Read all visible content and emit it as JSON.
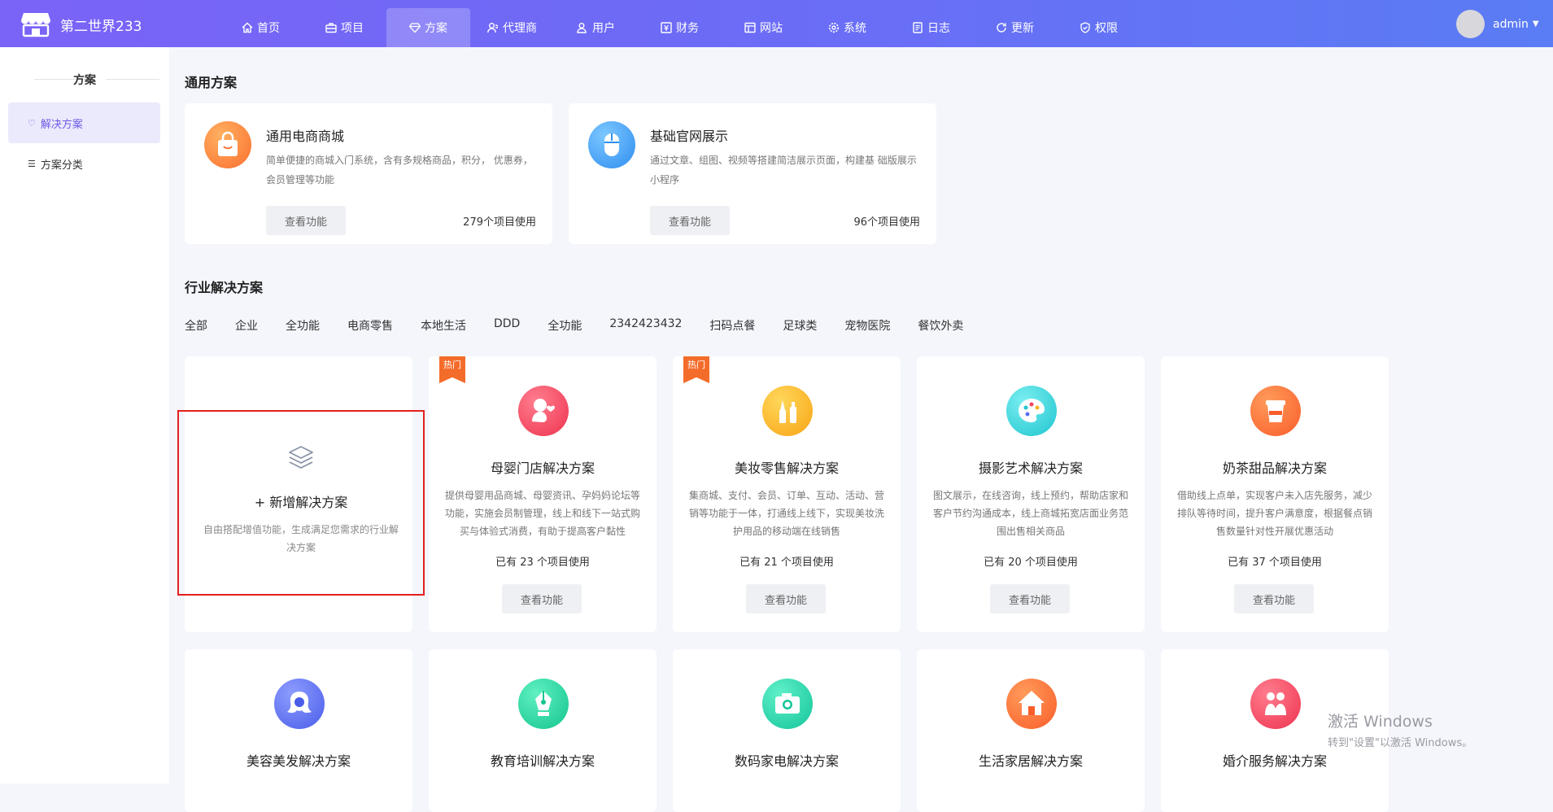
{
  "app": {
    "title": "第二世界233"
  },
  "nav": [
    {
      "label": "首页",
      "icon": "home-icon"
    },
    {
      "label": "项目",
      "icon": "briefcase-icon"
    },
    {
      "label": "方案",
      "icon": "diamond-icon",
      "active": true
    },
    {
      "label": "代理商",
      "icon": "agent-icon"
    },
    {
      "label": "用户",
      "icon": "users-icon"
    },
    {
      "label": "财务",
      "icon": "finance-icon"
    },
    {
      "label": "网站",
      "icon": "website-icon"
    },
    {
      "label": "系统",
      "icon": "gear-icon"
    },
    {
      "label": "日志",
      "icon": "log-icon"
    },
    {
      "label": "更新",
      "icon": "refresh-icon"
    },
    {
      "label": "权限",
      "icon": "shield-icon"
    }
  ],
  "user": {
    "name": "admin"
  },
  "sidebar": {
    "title": "方案",
    "items": [
      {
        "label": "解决方案",
        "icon": "diamond-icon",
        "active": true
      },
      {
        "label": "方案分类",
        "icon": "list-icon"
      }
    ]
  },
  "general": {
    "title": "通用方案",
    "cards": [
      {
        "name": "通用电商商城",
        "desc": "简单便捷的商城入门系统，含有多规格商品，积分， 优惠券，会员管理等功能",
        "button": "查看功能",
        "count": "279个项目使用",
        "icon": "shopping-bag-icon",
        "color": "#fb7a3a"
      },
      {
        "name": "基础官网展示",
        "desc": "通过文章、组图、视频等搭建简洁展示页面，构建基 础版展示小程序",
        "button": "查看功能",
        "count": "96个项目使用",
        "icon": "mouse-icon",
        "color": "#3d9df2"
      }
    ]
  },
  "industry": {
    "title": "行业解决方案",
    "filters": [
      "全部",
      "企业",
      "全功能",
      "电商零售",
      "本地生活",
      "DDD",
      "全功能",
      "2342423432",
      "扫码点餐",
      "足球类",
      "宠物医院",
      "餐饮外卖"
    ],
    "add": {
      "title": "+ 新增解决方案",
      "desc": "自由搭配增值功能，生成满足您需求的行业解决方案",
      "icon": "layers-icon"
    },
    "cards": [
      {
        "name": "母婴门店解决方案",
        "badge": "热门",
        "desc": "提供母婴用品商城、母婴资讯、孕妈妈论坛等功能，实施会员制管理，线上和线下一站式购买与体验式消费，有助于提高客户黏性",
        "count": "已有 23 个项目使用",
        "button": "查看功能",
        "icon": "baby-icon",
        "color": "#f2445f"
      },
      {
        "name": "美妆零售解决方案",
        "badge": "热门",
        "desc": "集商城、支付、会员、订单、互动、活动、营销等功能于一体，打通线上线下，实现美妆洗护用品的移动端在线销售",
        "count": "已有 21 个项目使用",
        "button": "查看功能",
        "icon": "cosmetics-icon",
        "color": "#fbb51e"
      },
      {
        "name": "摄影艺术解决方案",
        "badge": "",
        "desc": "图文展示，在线咨询，线上预约，帮助店家和客户节约沟通成本，线上商城拓宽店面业务范围出售相关商品",
        "count": "已有 20 个项目使用",
        "button": "查看功能",
        "icon": "palette-icon",
        "color": "#2fd3d8"
      },
      {
        "name": "奶茶甜品解决方案",
        "badge": "",
        "desc": "借助线上点单，实现客户未入店先服务，减少排队等待时间，提升客户满意度，根据餐点销售数量针对性开展优惠活动",
        "count": "已有 37 个项目使用",
        "button": "查看功能",
        "icon": "milk-tea-icon",
        "color": "#fb6c34"
      },
      {
        "name": "美容美发解决方案",
        "badge": "",
        "icon": "beauty-icon",
        "color": "#5a6ef2"
      },
      {
        "name": "教育培训解决方案",
        "badge": "",
        "icon": "pen-icon",
        "color": "#1fcf98"
      },
      {
        "name": "数码家电解决方案",
        "badge": "",
        "icon": "camera-icon",
        "color": "#1fcfa0"
      },
      {
        "name": "生活家居解决方案",
        "badge": "",
        "icon": "house-icon",
        "color": "#fb6c34"
      },
      {
        "name": "婚介服务解决方案",
        "badge": "",
        "icon": "couple-icon",
        "color": "#f2445f"
      }
    ]
  },
  "watermark": {
    "line1": "激活 Windows",
    "line2": "转到\"设置\"以激活 Windows。"
  }
}
